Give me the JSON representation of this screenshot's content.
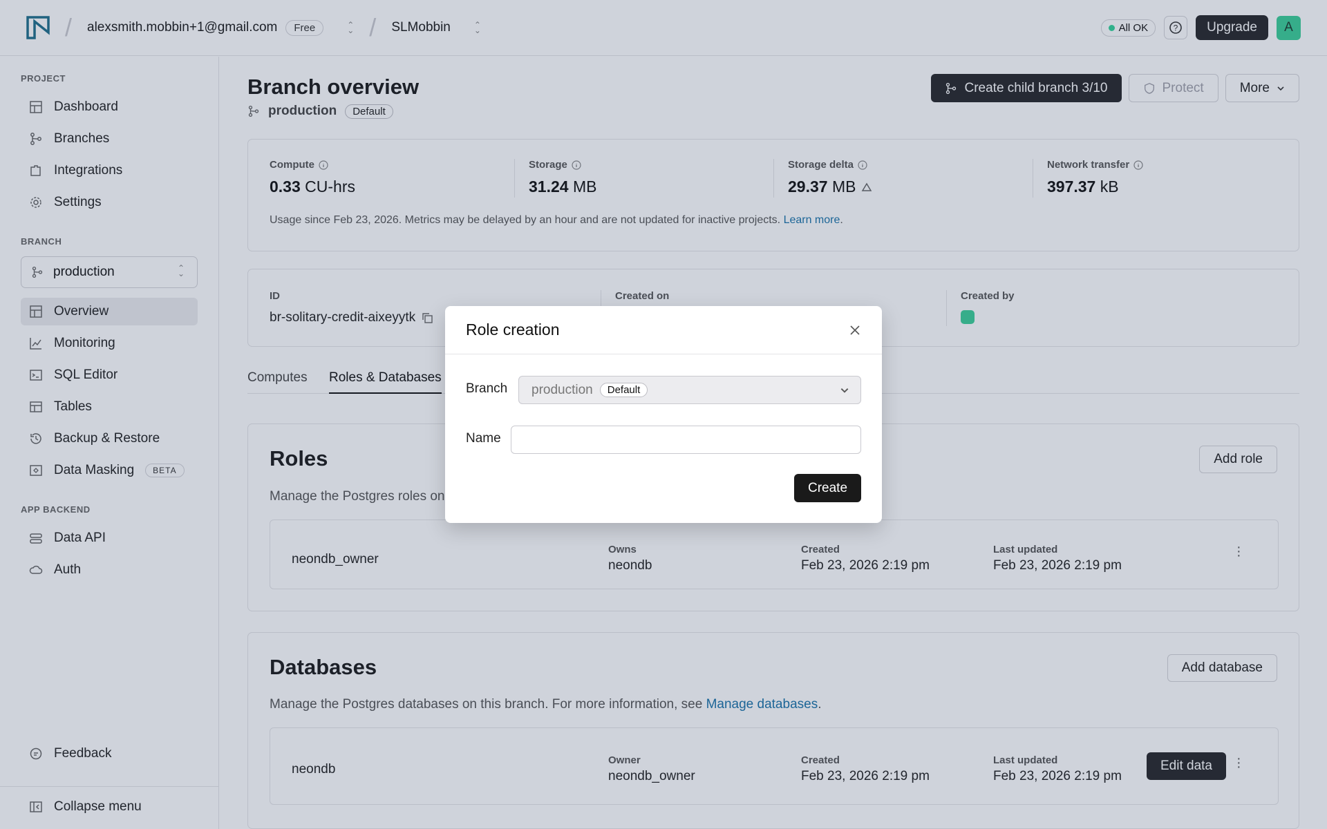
{
  "header": {
    "account": "alexsmith.mobbin+1@gmail.com",
    "plan": "Free",
    "project": "SLMobbin",
    "status": "All OK",
    "upgrade_label": "Upgrade",
    "avatar_letter": "A"
  },
  "sidebar": {
    "project_label": "PROJECT",
    "project_items": [
      "Dashboard",
      "Branches",
      "Integrations",
      "Settings"
    ],
    "branch_label": "BRANCH",
    "branch_name": "production",
    "branch_items": [
      "Overview",
      "Monitoring",
      "SQL Editor",
      "Tables",
      "Backup & Restore",
      "Data Masking"
    ],
    "beta_badge": "BETA",
    "app_backend_label": "APP BACKEND",
    "app_items": [
      "Data API",
      "Auth"
    ],
    "feedback": "Feedback",
    "collapse": "Collapse menu"
  },
  "page": {
    "title": "Branch overview",
    "branch_name": "production",
    "default_badge": "Default",
    "create_child_label": "Create child branch 3/10",
    "protect_label": "Protect",
    "more_label": "More"
  },
  "metrics": {
    "compute": {
      "label": "Compute",
      "value": "0.33",
      "unit": "CU-hrs"
    },
    "storage": {
      "label": "Storage",
      "value": "31.24",
      "unit": "MB"
    },
    "storage_delta": {
      "label": "Storage delta",
      "value": "29.37",
      "unit": "MB"
    },
    "network": {
      "label": "Network transfer",
      "value": "397.37",
      "unit": "kB"
    },
    "note": "Usage since Feb 23, 2026. Metrics may be delayed by an hour and are not updated for inactive projects.",
    "learn_more": "Learn more",
    "period": "."
  },
  "info": {
    "id_label": "ID",
    "id_value": "br-solitary-credit-aixeyytk",
    "created_on_label": "Created on",
    "created_by_label": "Created by"
  },
  "tabs": [
    "Computes",
    "Roles & Databases"
  ],
  "roles": {
    "title": "Roles",
    "desc": "Manage the Postgres roles on",
    "add_label": "Add role",
    "row": {
      "name": "neondb_owner",
      "owns_label": "Owns",
      "owns": "neondb",
      "created_label": "Created",
      "created": "Feb 23, 2026 2:19 pm",
      "updated_label": "Last updated",
      "updated": "Feb 23, 2026 2:19 pm"
    }
  },
  "databases": {
    "title": "Databases",
    "desc": "Manage the Postgres databases on this branch. For more information, see",
    "desc_link": "Manage databases",
    "period": ".",
    "add_label": "Add database",
    "row": {
      "name": "neondb",
      "owner_label": "Owner",
      "owner": "neondb_owner",
      "created_label": "Created",
      "created": "Feb 23, 2026 2:19 pm",
      "updated_label": "Last updated",
      "updated": "Feb 23, 2026 2:19 pm",
      "edit_label": "Edit data"
    }
  },
  "modal": {
    "title": "Role creation",
    "branch_label": "Branch",
    "branch_value": "production",
    "branch_badge": "Default",
    "name_label": "Name",
    "name_value": "",
    "create_label": "Create"
  },
  "colors": {
    "accent": "#27272a",
    "status_ok": "#34d399",
    "avatar": "#3bcf98",
    "link": "#1a73a8"
  }
}
